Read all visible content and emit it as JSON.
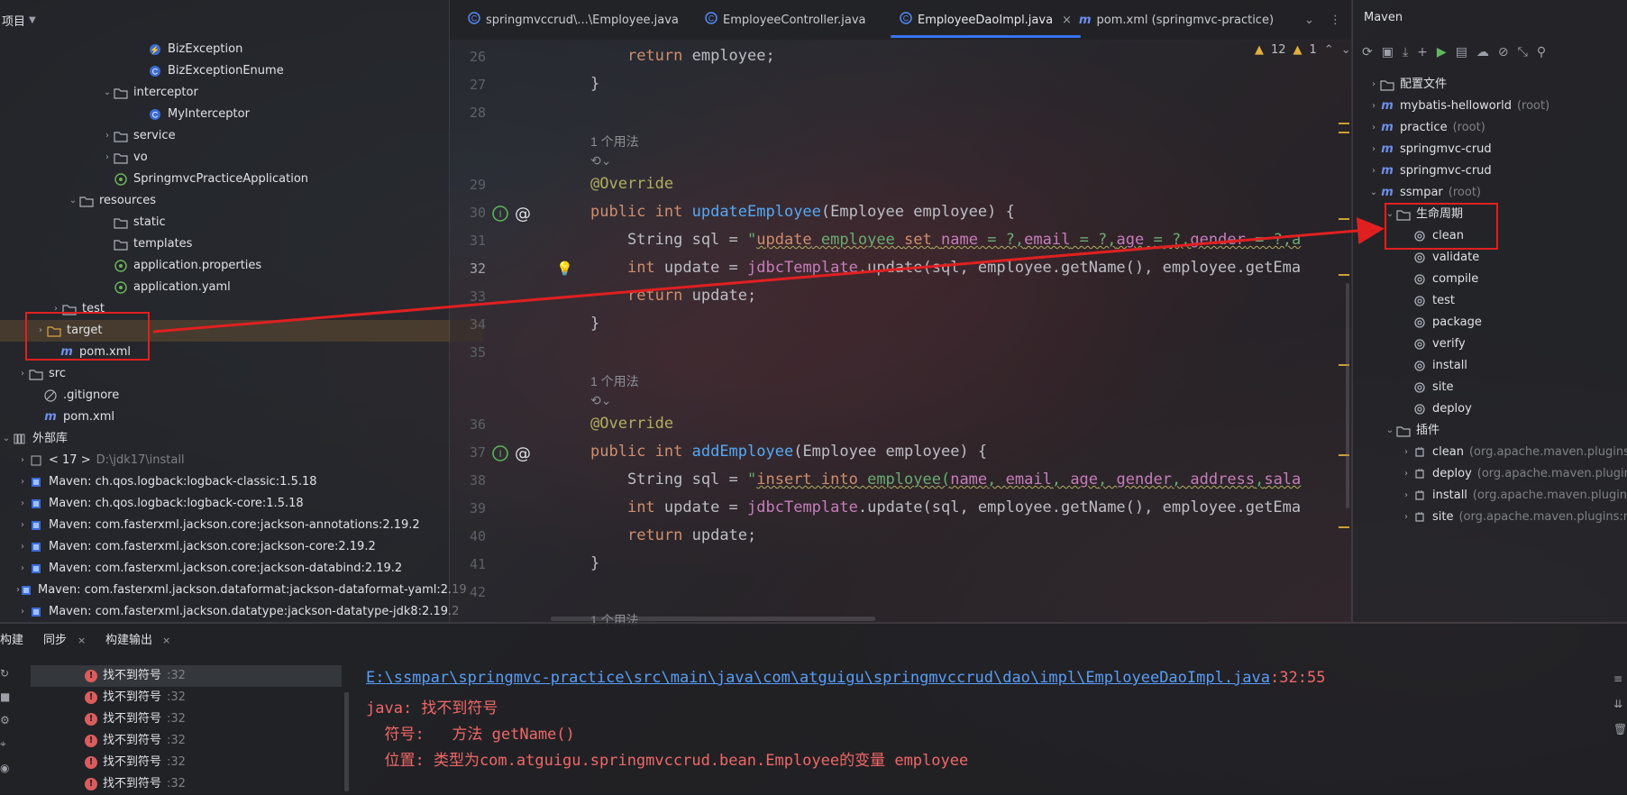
{
  "project": {
    "header_label": "项目",
    "rows": [
      {
        "label": "BizException",
        "muted": ""
      },
      {
        "label": "BizExceptionEnume",
        "muted": ""
      },
      {
        "label": "interceptor",
        "muted": ""
      },
      {
        "label": "MyInterceptor",
        "muted": ""
      },
      {
        "label": "service",
        "muted": ""
      },
      {
        "label": "vo",
        "muted": ""
      },
      {
        "label": "SpringmvcPracticeApplication",
        "muted": ""
      },
      {
        "label": "resources",
        "muted": ""
      },
      {
        "label": "static",
        "muted": ""
      },
      {
        "label": "templates",
        "muted": ""
      },
      {
        "label": "application.properties",
        "muted": ""
      },
      {
        "label": "application.yaml",
        "muted": ""
      },
      {
        "label": "test",
        "muted": ""
      },
      {
        "label": "target",
        "muted": ""
      },
      {
        "label": "pom.xml",
        "muted": ""
      },
      {
        "label": "src",
        "muted": ""
      },
      {
        "label": ".gitignore",
        "muted": ""
      },
      {
        "label": "pom.xml",
        "muted": ""
      },
      {
        "label": "外部库",
        "muted": ""
      },
      {
        "label": "< 17 >",
        "muted": "D:\\jdk17\\install"
      },
      {
        "label": "Maven: ch.qos.logback:logback-classic:1.5.18",
        "muted": ""
      },
      {
        "label": "Maven: ch.qos.logback:logback-core:1.5.18",
        "muted": ""
      },
      {
        "label": "Maven: com.fasterxml.jackson.core:jackson-annotations:2.19.2",
        "muted": ""
      },
      {
        "label": "Maven: com.fasterxml.jackson.core:jackson-core:2.19.2",
        "muted": ""
      },
      {
        "label": "Maven: com.fasterxml.jackson.core:jackson-databind:2.19.2",
        "muted": ""
      },
      {
        "label": "Maven: com.fasterxml.jackson.dataformat:jackson-dataformat-yaml:2.19",
        "muted": ""
      },
      {
        "label": "Maven: com.fasterxml.jackson.datatype:jackson-datatype-jdk8:2.19.2",
        "muted": ""
      }
    ]
  },
  "tabs": [
    {
      "label": "springmvccrud\\...\\Employee.java"
    },
    {
      "label": "EmployeeController.java"
    },
    {
      "label": "EmployeeDaoImpl.java"
    },
    {
      "label": "pom.xml (springmvc-practice)"
    }
  ],
  "editor": {
    "warnings": "12",
    "weak_warnings": "1",
    "usage_hint": "1 个用法",
    "line_numbers": [
      "26",
      "27",
      "28",
      "29",
      "30",
      "31",
      "32",
      "33",
      "34",
      "35",
      "36",
      "37",
      "38",
      "39",
      "40",
      "41",
      "42"
    ]
  },
  "maven": {
    "title": "Maven",
    "projects": [
      {
        "label": "配置文件",
        "muted": ""
      },
      {
        "label": "mybatis-helloworld",
        "muted": "(root)"
      },
      {
        "label": "practice",
        "muted": "(root)"
      },
      {
        "label": "springmvc-crud",
        "muted": ""
      },
      {
        "label": "springmvc-crud",
        "muted": ""
      },
      {
        "label": "ssmpar",
        "muted": "(root)"
      }
    ],
    "lifecycle_label": "生命周期",
    "lifecycle": [
      "clean",
      "validate",
      "compile",
      "test",
      "package",
      "verify",
      "install",
      "site",
      "deploy"
    ],
    "plugins_label": "插件",
    "plugins": [
      {
        "label": "clean",
        "muted": "(org.apache.maven.plugins:m"
      },
      {
        "label": "deploy",
        "muted": "(org.apache.maven.plugins"
      },
      {
        "label": "install",
        "muted": "(org.apache.maven.plugins:"
      },
      {
        "label": "site",
        "muted": "(org.apache.maven.plugins:ma"
      }
    ]
  },
  "bottom": {
    "tabs": [
      "构建",
      "同步",
      "构建输出"
    ],
    "errors": [
      {
        "label": "找不到符号",
        "line": ":32"
      },
      {
        "label": "找不到符号",
        "line": ":32"
      },
      {
        "label": "找不到符号",
        "line": ":32"
      },
      {
        "label": "找不到符号",
        "line": ":32"
      },
      {
        "label": "找不到符号",
        "line": ":32"
      },
      {
        "label": "找不到符号",
        "line": ":32"
      }
    ],
    "output": {
      "path": "E:\\ssmpar\\springmvc-practice\\src\\main\\java\\com\\atguigu\\springmvccrud\\dao\\impl\\EmployeeDaoImpl.java",
      "pos": ":32:55",
      "line2": "java: 找不到符号",
      "line3": "  符号:   方法 getName()",
      "line4": "  位置: 类型为com.atguigu.springmvccrud.bean.Employee的变量 employee"
    }
  }
}
